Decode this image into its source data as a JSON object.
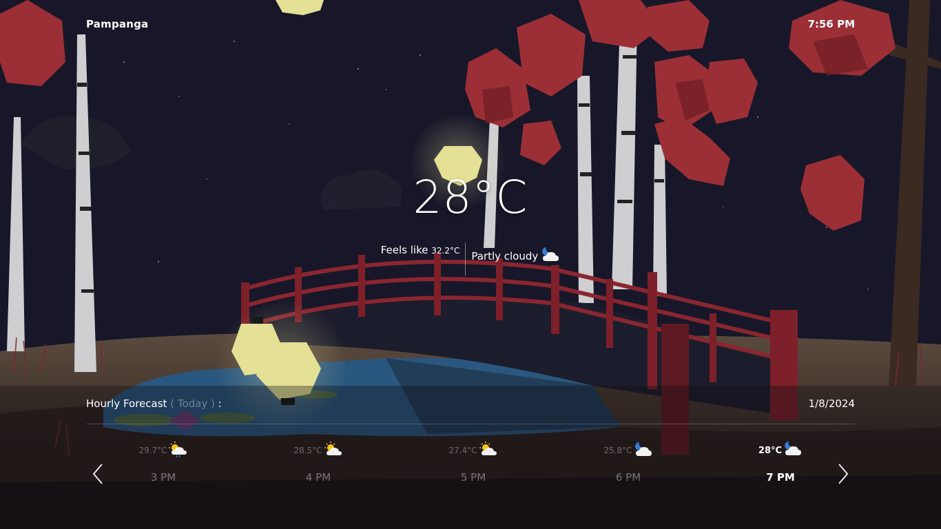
{
  "location": "Pampanga",
  "time": "7:56 PM",
  "current": {
    "temperature": "28°C",
    "feels_like_label": "Feels like",
    "feels_like_value": "32.2",
    "feels_like_unit": "°C",
    "condition": "Partly cloudy",
    "condition_icon": "moon-cloud-icon"
  },
  "hourly": {
    "title": "Hourly Forecast",
    "subtitle": "( Today )",
    "colon": " :",
    "date": "1/8/2024",
    "items": [
      {
        "temp": "29.7°C",
        "label": "3 PM",
        "icon": "sun-cloud-rain-icon",
        "active": false
      },
      {
        "temp": "28.5°C",
        "label": "4 PM",
        "icon": "sun-cloud-icon",
        "active": false
      },
      {
        "temp": "27.4°C",
        "label": "5 PM",
        "icon": "sun-cloud-icon",
        "active": false
      },
      {
        "temp": "25.8°C",
        "label": "6 PM",
        "icon": "moon-cloud-icon",
        "active": false
      },
      {
        "temp": "28°C",
        "label": "7 PM",
        "icon": "moon-cloud-icon",
        "active": true
      }
    ]
  },
  "colors": {
    "sky": "#161629",
    "bridge": "#7a1f28",
    "foliage": "#a8323a",
    "water": "#2b5a86",
    "lantern": "#e6e29a",
    "ground": "#4a3a30"
  }
}
